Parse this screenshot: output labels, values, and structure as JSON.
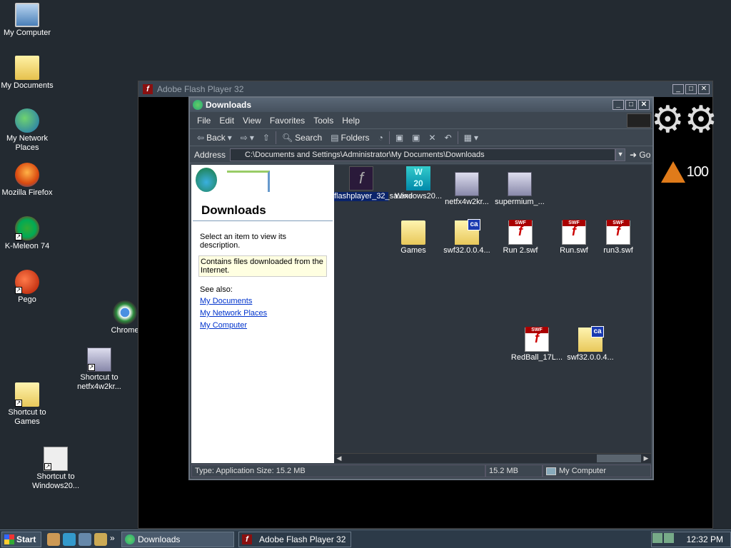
{
  "desktop": {
    "icons": [
      {
        "label": "My Computer",
        "icon": "computer-icon"
      },
      {
        "label": "My Documents",
        "icon": "documents-icon"
      },
      {
        "label": "My Network Places",
        "icon": "network-icon"
      },
      {
        "label": "Mozilla Firefox",
        "icon": "firefox-icon"
      },
      {
        "label": "K-Meleon 74",
        "icon": "kmeleon-icon"
      },
      {
        "label": "Pego",
        "icon": "pego-icon"
      },
      {
        "label": "Chrome",
        "icon": "chrome-icon"
      },
      {
        "label": "Shortcut to netfx4w2kr...",
        "icon": "setup-icon"
      },
      {
        "label": "Shortcut to Games",
        "icon": "folder-icon"
      },
      {
        "label": "Shortcut to Windows20...",
        "icon": "file-icon"
      }
    ]
  },
  "flash_window": {
    "title": "Adobe Flash Player 32",
    "score": "100"
  },
  "downloads_window": {
    "title": "Downloads",
    "menu": [
      "File",
      "Edit",
      "View",
      "Favorites",
      "Tools",
      "Help"
    ],
    "toolbar": {
      "back": "Back",
      "search": "Search",
      "folders": "Folders"
    },
    "address": {
      "label": "Address",
      "value": "C:\\Documents and Settings\\Administrator\\My Documents\\Downloads",
      "go": "Go"
    },
    "taskpane": {
      "title": "Downloads",
      "select_prompt": "Select an item to view its description.",
      "description": "Contains files downloaded from the Internet.",
      "see_also": "See also:",
      "links": [
        "My Documents",
        "My Network Places",
        "My Computer"
      ]
    },
    "files": [
      {
        "label": "flashplayer_32_sa.exe",
        "icon": "flash-exe-icon",
        "selected": true
      },
      {
        "label": "Windows20...",
        "icon": "win20-icon"
      },
      {
        "label": "netfx4w2kr...",
        "icon": "setup-icon"
      },
      {
        "label": "supermium_...",
        "icon": "setup-icon"
      },
      {
        "label": "Games",
        "icon": "folder-icon"
      },
      {
        "label": "swf32.0.0.4...",
        "icon": "ca-folder-icon"
      },
      {
        "label": "Run 2.swf",
        "icon": "swf-icon"
      },
      {
        "label": "Run.swf",
        "icon": "swf-icon"
      },
      {
        "label": "run3.swf",
        "icon": "swf-icon"
      },
      {
        "label": "RedBall_17L...",
        "icon": "swf-icon"
      },
      {
        "label": "swf32.0.0.4...",
        "icon": "ca-folder-icon"
      }
    ],
    "status": {
      "info": "Type: Application Size: 15.2 MB",
      "size": "15.2 MB",
      "zone": "My Computer"
    }
  },
  "taskbar": {
    "start": "Start",
    "tasks": [
      "Downloads",
      "Adobe Flash Player 32"
    ],
    "quicklaunch_more": "»",
    "clock": "12:32 PM"
  }
}
